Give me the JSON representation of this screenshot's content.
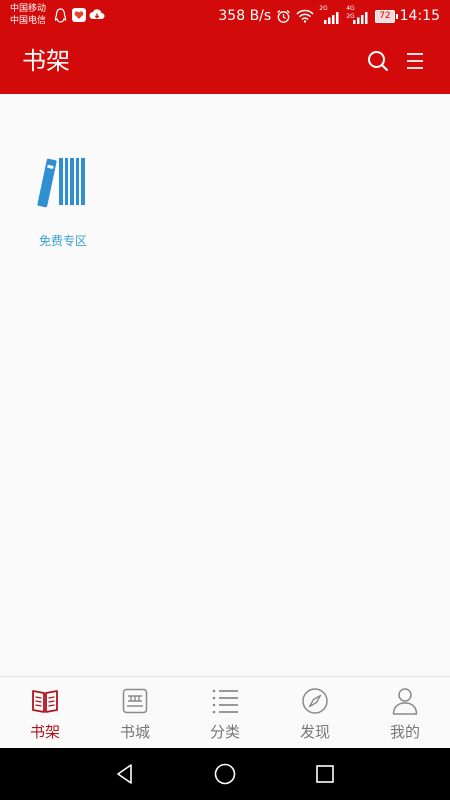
{
  "status_bar": {
    "carrier_1": "中国移动",
    "carrier_2": "中国电信",
    "net_speed": "358 B/s",
    "net_type_1": "2G",
    "net_type_2": "4G",
    "net_type_3": "2G",
    "battery": "72",
    "time": "14:15"
  },
  "app_bar": {
    "title": "书架",
    "search_icon": "search-icon",
    "menu_icon": "menu-icon"
  },
  "shelf": {
    "items": [
      {
        "label": "免费专区",
        "icon": "bookshelf-books-icon"
      }
    ]
  },
  "bottom_nav": {
    "items": [
      {
        "label": "书架",
        "icon": "open-book-icon",
        "active": true
      },
      {
        "label": "书城",
        "icon": "bookstore-icon",
        "active": false
      },
      {
        "label": "分类",
        "icon": "list-icon",
        "active": false
      },
      {
        "label": "发现",
        "icon": "compass-icon",
        "active": false
      },
      {
        "label": "我的",
        "icon": "user-icon",
        "active": false
      }
    ]
  },
  "colors": {
    "brand": "#d30a0a",
    "active_tab": "#b3121b",
    "inactive_tab": "#777777",
    "book_icon": "#3aa2d4"
  }
}
